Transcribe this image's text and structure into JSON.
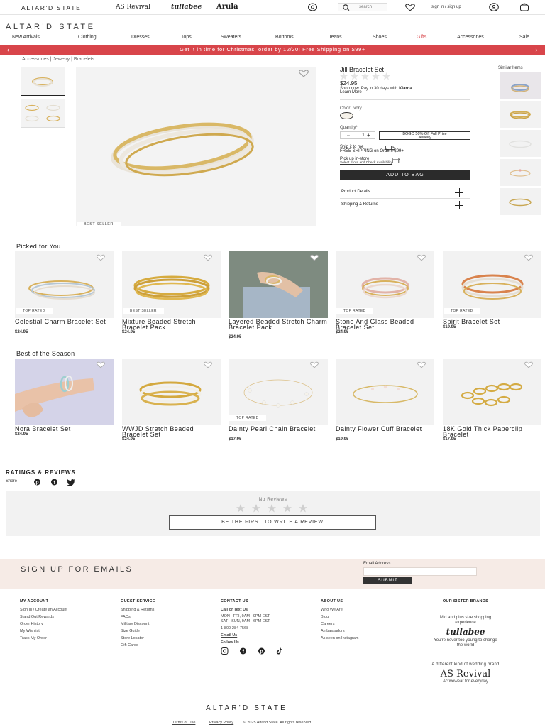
{
  "brands": {
    "main": "ALTAR'D STATE",
    "as_revival": "AS Revival",
    "tullabee": "tullabee",
    "arula": "Arula"
  },
  "header": {
    "search_placeholder": "search",
    "sign_in": "sign in / sign up",
    "logo": "ALTAR'D STATE"
  },
  "nav": {
    "items": [
      "New Arrivals",
      "Clothing",
      "Dresses",
      "Tops",
      "Sweaters",
      "Bottoms",
      "Jeans",
      "Shoes",
      "Gifts",
      "Accessories",
      "Sale"
    ],
    "highlight_color": "#d8454a"
  },
  "promo": {
    "text": "Get it in time for Christmas, order by 12/20! Free Shipping on $99+",
    "color": "#d8454a"
  },
  "breadcrumb": "Accessories | Jewelry | Bracelets",
  "product": {
    "badge": "BEST SELLER",
    "name": "Jill Bracelet Set",
    "price": "$24.95",
    "klarna_text": "Shop now. Pay in 30 days with",
    "klarna_brand": "Klarna.",
    "learn_more": "Learn More",
    "color_label": "Color: Ivory",
    "quantity_label": "Quantity*",
    "quantity_value": "1",
    "qty_minus": "–",
    "qty_plus": "+",
    "bogo_line1": "BOGO 50% Off Full Price",
    "bogo_line2": "Jewelry",
    "ship_label": "Ship it to me",
    "free_shipping": "FREE SHIPPING on Orders $99+",
    "pickup_label": "Pick up in-store",
    "pickup_link": "Select Store and Check Availability",
    "add_to_bag": "ADD TO BAG",
    "details": "Product Details",
    "shipping_returns": "Shipping & Returns",
    "similar_label": "Similar Items"
  },
  "picked": {
    "title": "Picked for You",
    "items": [
      {
        "name": "Celestial Charm Bracelet Set",
        "price": "$24.95",
        "badge": "TOP RATED"
      },
      {
        "name": "Mixture Beaded Stretch Bracelet Pack",
        "price": "$24.95",
        "badge": "BEST SELLER"
      },
      {
        "name": "Layered Beaded Stretch Charm Bracelet Pack",
        "price": "$24.95",
        "badge": ""
      },
      {
        "name": "Stone And Glass Beaded Bracelet Set",
        "price": "$24.95",
        "badge": "TOP RATED"
      },
      {
        "name": "Spirit Bracelet Set",
        "price": "$19.95",
        "badge": "TOP RATED"
      }
    ]
  },
  "season": {
    "title": "Best of the Season",
    "items": [
      {
        "name": "Nora Bracelet Set",
        "price": "$24.95",
        "badge": ""
      },
      {
        "name": "WWJD Stretch Beaded Bracelet Set",
        "price": "$24.95",
        "badge": ""
      },
      {
        "name": "Dainty Pearl Chain Bracelet",
        "price": "$17.95",
        "badge": "TOP RATED"
      },
      {
        "name": "Dainty Flower Cuff Bracelet",
        "price": "$19.95",
        "badge": ""
      },
      {
        "name": "18K Gold Thick Paperclip Bracelet",
        "price": "$17.95",
        "badge": ""
      }
    ]
  },
  "reviews": {
    "title": "RATINGS & REVIEWS",
    "share": "Share",
    "no_reviews": "No Reviews",
    "write_review": "BE THE FIRST TO WRITE A REVIEW"
  },
  "signup": {
    "title": "SIGN UP FOR EMAILS",
    "email_label": "Email Address",
    "submit": "SUBMIT",
    "bg_color": "#f6ebe6"
  },
  "footer": {
    "my_account": {
      "title": "MY ACCOUNT",
      "links": [
        "Sign In / Create an Account",
        "Stand Out Rewards",
        "Order History",
        "My Wishlist",
        "Track My Order"
      ]
    },
    "guest_service": {
      "title": "GUEST SERVICE",
      "links": [
        "Shipping & Returns",
        "FAQs",
        "Military Discount",
        "Size Guide",
        "Store Locator",
        "Gift Cards"
      ]
    },
    "contact": {
      "title": "CONTACT US",
      "call": "Call or Text Us",
      "hours1": "MON - FRI, 9AM - 9PM EST",
      "hours2": "SAT - SUN, 9AM - 6PM EST",
      "phone": "1-800-284-7568",
      "email": "Email Us",
      "follow": "Follow Us"
    },
    "about": {
      "title": "ABOUT US",
      "links": [
        "Who We Are",
        "Blog",
        "Careers",
        "Ambassadors",
        "As seen on Instagram"
      ]
    },
    "sister": {
      "title": "OUR SISTER BRANDS",
      "tullabee_tag1": "Mid and plus size shopping",
      "tullabee_tag2": "experience",
      "tullabee": "tullabee",
      "tullabee_sub1": "You're never too young to change",
      "tullabee_sub2": "the world",
      "wedding": "A different kind of wedding brand",
      "as_revival": "AS Revival",
      "activewear": "Activewear for everyday"
    },
    "logo": "ALTAR'D STATE",
    "terms": "Terms of Use",
    "privacy": "Privacy Policy",
    "copyright": "© 2025 Altar'd State. All rights reserved."
  }
}
